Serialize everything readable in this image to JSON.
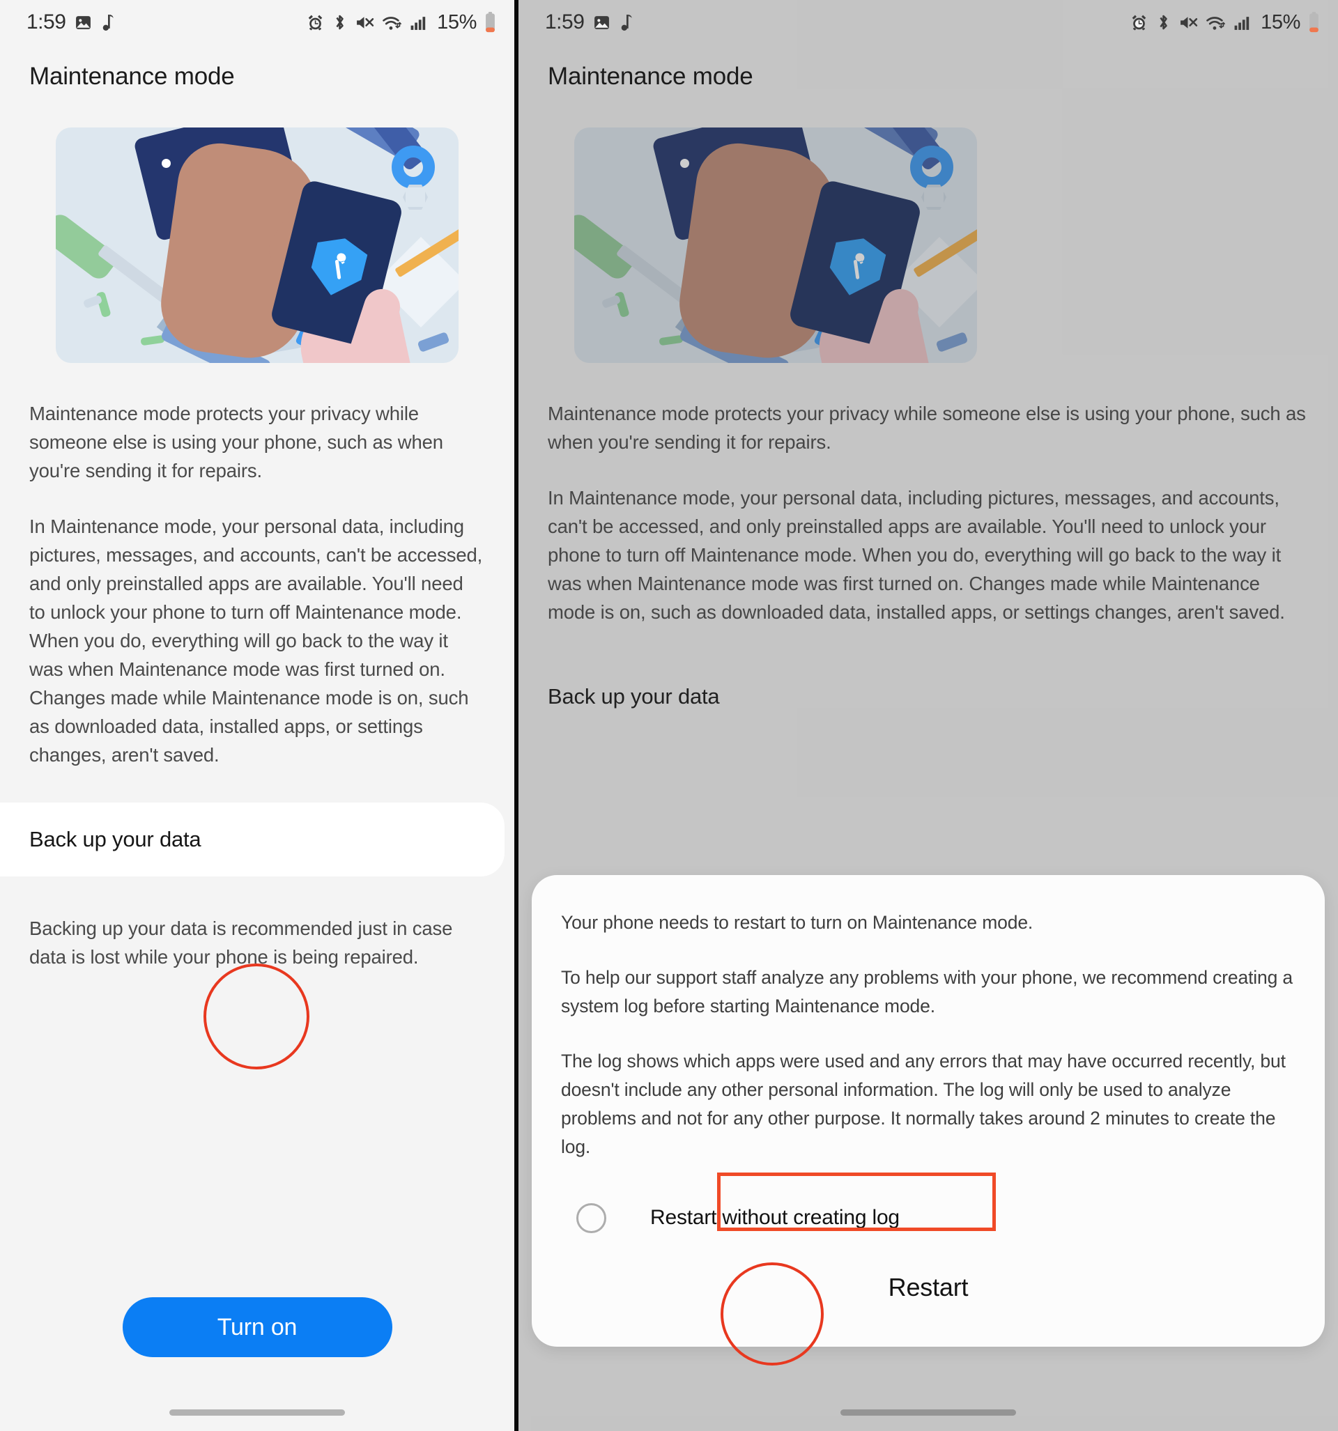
{
  "status_bar": {
    "time": "1:59",
    "battery_percent": "15%",
    "icons": [
      "image-icon",
      "music-note-icon",
      "alarm-icon",
      "bluetooth-icon",
      "mute-icon",
      "wifi-icon",
      "signal-icon",
      "battery-icon"
    ]
  },
  "page": {
    "title": "Maintenance mode",
    "illustration_alt": "phone-repair-illustration",
    "paragraph_1": "Maintenance mode protects your privacy while someone else is using your phone, such as when you're sending it for repairs.",
    "paragraph_2": "In Maintenance mode, your personal data, including pictures, messages, and accounts, can't be accessed, and only preinstalled apps are available. You'll need to unlock your phone to turn off Maintenance mode. When you do, everything will go back to the way it was when Maintenance mode was first turned on. Changes made while Maintenance mode is on, such as downloaded data, installed apps, or settings changes, aren't saved.",
    "backup_card_title": "Back up your data",
    "backup_note": "Backing up your data is recommended just in case data is lost while your phone is being repaired.",
    "turn_on_label": "Turn on"
  },
  "dialog": {
    "paragraph_1": "Your phone needs to restart to turn on Maintenance mode.",
    "paragraph_2": "To help our support staff analyze any problems with your phone, we recommend creating a system log before starting Maintenance mode.",
    "paragraph_3": "The log shows which apps were used and any errors that may have occurred recently, but doesn't include any other personal information. The log will only be used to analyze problems and not for any other purpose. It normally takes around 2 minutes to create the log.",
    "radio_label": "Restart without creating log",
    "radio_checked": false,
    "restart_label": "Restart"
  },
  "colors": {
    "accent_blue": "#0b7ef4",
    "annotation_red": "#e8381f",
    "page_bg": "#f4f4f4",
    "card_bg": "#ffffff",
    "hero_bg": "#dde7ef"
  }
}
